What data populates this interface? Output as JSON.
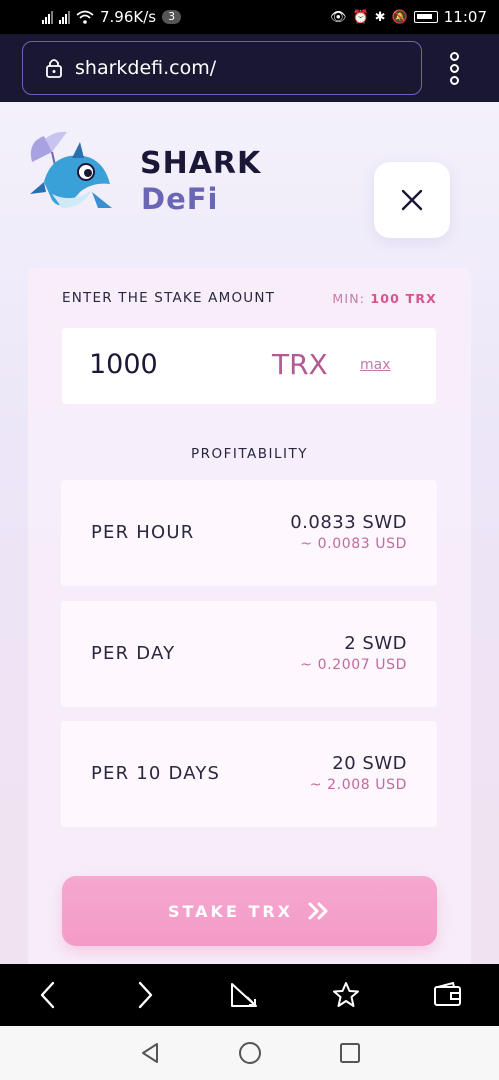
{
  "status_bar": {
    "speed": "7.96K/s",
    "badge": "3",
    "time": "11:07"
  },
  "browser": {
    "url": "sharkdefi.com/"
  },
  "brand": {
    "line1": "SHARK",
    "line2": "DeFi"
  },
  "stake": {
    "label": "ENTER THE STAKE AMOUNT",
    "min_prefix": "MIN:",
    "min_value": "100 TRX",
    "amount": "1000",
    "unit": "TRX",
    "max_link": "max"
  },
  "profitability": {
    "title": "PROFITABILITY",
    "rows": [
      {
        "label": "PER HOUR",
        "swd": "0.0833 SWD",
        "usd": "~ 0.0083 USD"
      },
      {
        "label": "PER DAY",
        "swd": "2 SWD",
        "usd": "~ 0.2007 USD"
      },
      {
        "label": "PER 10 DAYS",
        "swd": "20 SWD",
        "usd": "~ 2.008 USD"
      }
    ]
  },
  "button": {
    "label": "STAKE TRX"
  },
  "colors": {
    "accent_pink": "#f39bc7",
    "trx_purple": "#b25a93",
    "brand_blue": "#6a66b5",
    "dark_text": "#1b1736"
  },
  "icons": {
    "browser_bottom": [
      "back-icon",
      "forward-icon",
      "data-saver-icon",
      "bookmark-star-icon",
      "wallet-icon"
    ],
    "system_nav": [
      "nav-back-icon",
      "nav-home-icon",
      "nav-recents-icon"
    ]
  }
}
